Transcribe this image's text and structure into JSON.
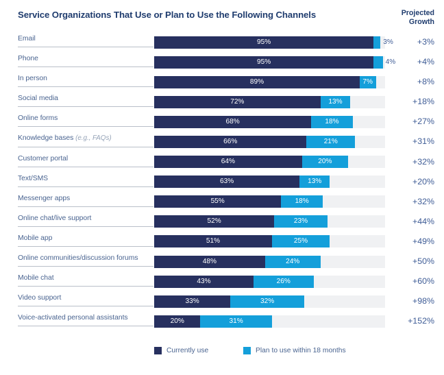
{
  "header": {
    "title": "Service Organizations That Use or Plan to Use the Following Channels",
    "growth_header_line1": "Projected",
    "growth_header_line2": "Growth"
  },
  "legend": {
    "items": [
      {
        "label": "Currently use",
        "color": "#27305f"
      },
      {
        "label": "Plan to use within 18 months",
        "color": "#149fda"
      }
    ]
  },
  "colors": {
    "current": "#27305f",
    "plan": "#149fda",
    "track": "#f0f1f3",
    "label_text": "#4a6490",
    "title_text": "#1f3c6e",
    "growth_text": "#3e5c96",
    "rule": "#b9bfc9"
  },
  "chart_data": {
    "type": "bar",
    "title": "Service Organizations That Use or Plan to Use the Following Channels",
    "subtitle": "",
    "orientation": "horizontal",
    "stacked": true,
    "xlabel": "",
    "ylabel": "",
    "xlim": [
      0,
      100
    ],
    "grid": false,
    "legend_position": "bottom",
    "categories": [
      "Email",
      "Phone",
      "In person",
      "Social media",
      "Online forms",
      "Knowledge bases (e.g., FAQs)",
      "Customer portal",
      "Text/SMS",
      "Messenger apps",
      "Online chat/live support",
      "Mobile app",
      "Online communities/discussion forums",
      "Mobile chat",
      "Video support",
      "Voice-activated personal assistants"
    ],
    "series": [
      {
        "name": "Currently use",
        "color": "#27305f",
        "values": [
          95,
          95,
          89,
          72,
          68,
          66,
          64,
          63,
          55,
          52,
          51,
          48,
          43,
          33,
          20
        ]
      },
      {
        "name": "Plan to use within 18 months",
        "color": "#149fda",
        "values": [
          3,
          4,
          7,
          13,
          18,
          21,
          20,
          13,
          18,
          23,
          25,
          24,
          26,
          32,
          31
        ]
      }
    ],
    "annotations": {
      "projected_growth": [
        "+3%",
        "+4%",
        "+8%",
        "+18%",
        "+27%",
        "+31%",
        "+32%",
        "+20%",
        "+32%",
        "+44%",
        "+49%",
        "+50%",
        "+60%",
        "+98%",
        "+152%"
      ]
    }
  },
  "rows": [
    {
      "label": "Email",
      "note": "",
      "current": 95,
      "plan": 3,
      "current_label": "95%",
      "plan_label": "3%",
      "plan_outside": true,
      "growth": "+3%"
    },
    {
      "label": "Phone",
      "note": "",
      "current": 95,
      "plan": 4,
      "current_label": "95%",
      "plan_label": "4%",
      "plan_outside": true,
      "growth": "+4%"
    },
    {
      "label": "In person",
      "note": "",
      "current": 89,
      "plan": 7,
      "current_label": "89%",
      "plan_label": "7%",
      "plan_outside": false,
      "growth": "+8%"
    },
    {
      "label": "Social media",
      "note": "",
      "current": 72,
      "plan": 13,
      "current_label": "72%",
      "plan_label": "13%",
      "plan_outside": false,
      "growth": "+18%"
    },
    {
      "label": "Online forms",
      "note": "",
      "current": 68,
      "plan": 18,
      "current_label": "68%",
      "plan_label": "18%",
      "plan_outside": false,
      "growth": "+27%"
    },
    {
      "label": "Knowledge bases ",
      "note": "(e.g., FAQs)",
      "current": 66,
      "plan": 21,
      "current_label": "66%",
      "plan_label": "21%",
      "plan_outside": false,
      "growth": "+31%"
    },
    {
      "label": "Customer portal",
      "note": "",
      "current": 64,
      "plan": 20,
      "current_label": "64%",
      "plan_label": "20%",
      "plan_outside": false,
      "growth": "+32%"
    },
    {
      "label": "Text/SMS",
      "note": "",
      "current": 63,
      "plan": 13,
      "current_label": "63%",
      "plan_label": "13%",
      "plan_outside": false,
      "growth": "+20%"
    },
    {
      "label": "Messenger apps",
      "note": "",
      "current": 55,
      "plan": 18,
      "current_label": "55%",
      "plan_label": "18%",
      "plan_outside": false,
      "growth": "+32%"
    },
    {
      "label": "Online chat/live support",
      "note": "",
      "current": 52,
      "plan": 23,
      "current_label": "52%",
      "plan_label": "23%",
      "plan_outside": false,
      "growth": "+44%"
    },
    {
      "label": "Mobile app",
      "note": "",
      "current": 51,
      "plan": 25,
      "current_label": "51%",
      "plan_label": "25%",
      "plan_outside": false,
      "growth": "+49%"
    },
    {
      "label": "Online communities/discussion forums",
      "note": "",
      "current": 48,
      "plan": 24,
      "current_label": "48%",
      "plan_label": "24%",
      "plan_outside": false,
      "growth": "+50%"
    },
    {
      "label": "Mobile chat",
      "note": "",
      "current": 43,
      "plan": 26,
      "current_label": "43%",
      "plan_label": "26%",
      "plan_outside": false,
      "growth": "+60%"
    },
    {
      "label": "Video support",
      "note": "",
      "current": 33,
      "plan": 32,
      "current_label": "33%",
      "plan_label": "32%",
      "plan_outside": false,
      "growth": "+98%"
    },
    {
      "label": "Voice-activated personal assistants",
      "note": "",
      "current": 20,
      "plan": 31,
      "current_label": "20%",
      "plan_label": "31%",
      "plan_outside": false,
      "growth": "+152%"
    }
  ]
}
